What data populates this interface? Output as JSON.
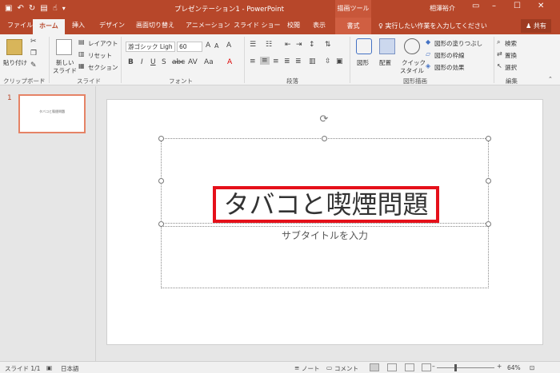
{
  "window": {
    "title": "プレゼンテーション1 - PowerPoint",
    "context_group": "描画ツール",
    "user": "相澤裕介",
    "controls": [
      "minimize-icon",
      "maximize-icon",
      "close-icon"
    ]
  },
  "qat": [
    "save-icon",
    "undo-icon",
    "redo-icon",
    "start-from-beginning-icon",
    "touch-mode-icon",
    "customize-icon"
  ],
  "tabs": [
    {
      "label": "ファイル"
    },
    {
      "label": "ホーム"
    },
    {
      "label": "挿入"
    },
    {
      "label": "デザイン"
    },
    {
      "label": "画面切り替え"
    },
    {
      "label": "アニメーション"
    },
    {
      "label": "スライド ショー"
    },
    {
      "label": "校閲"
    },
    {
      "label": "表示"
    },
    {
      "label": "書式"
    }
  ],
  "tellme": "実行したい作業を入力してください",
  "share": "共有",
  "ribbon": {
    "clipboard": {
      "label": "クリップボード",
      "paste": "貼り付け"
    },
    "slides": {
      "label": "スライド",
      "new_slide_line1": "新しい",
      "new_slide_line2": "スライド",
      "layout": "レイアウト",
      "reset": "リセット",
      "section": "セクション"
    },
    "font": {
      "label": "フォント",
      "font_name": "游ゴシック Ligh",
      "font_size": "60"
    },
    "paragraph": {
      "label": "段落"
    },
    "drawing": {
      "label": "図形描画",
      "shapes": "図形",
      "arrange": "配置",
      "quick_styles_line1": "クイック",
      "quick_styles_line2": "スタイル",
      "fill": "図形の塗りつぶし",
      "outline": "図形の枠線",
      "effects": "図形の効果"
    },
    "editing": {
      "label": "編集",
      "find": "検索",
      "replace": "置換",
      "select": "選択"
    }
  },
  "slides_pane": {
    "number": "1",
    "thumb_text": "タバコと喫煙問題"
  },
  "slide": {
    "title": "タバコと喫煙問題",
    "subtitle_placeholder": "サブタイトルを入力"
  },
  "status": {
    "slide_info": "スライド 1/1",
    "language": "日本語",
    "notes": "ノート",
    "comments": "コメント",
    "zoom": "64%",
    "zoom_fraction": 0.64
  },
  "colors": {
    "accent": "#b7472a",
    "highlight": "#e5101a"
  }
}
